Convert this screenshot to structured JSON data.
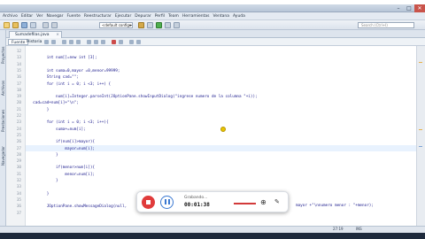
{
  "window": {
    "title": "",
    "controls": {
      "minimize": "–",
      "maximize": "□",
      "close": "✕"
    }
  },
  "menu": [
    "Archivo",
    "Editar",
    "Ver",
    "Navegar",
    "Fuente",
    "Reestructurar",
    "Ejecutar",
    "Depurar",
    "Perfil",
    "Team",
    "Herramientas",
    "Ventana",
    "Ayuda"
  ],
  "toolbar": {
    "config_value": "<default config>",
    "config_arrow": "▾",
    "search_placeholder": "Search (Ctrl+I)"
  },
  "left_panel_tabs": [
    "Proyectos",
    "Archivos",
    "Prestaciones",
    "Navegador"
  ],
  "editor": {
    "tab_label": "Sumadefilas.java",
    "tab_close": "×",
    "sub_tabs": [
      "Fuente",
      "Historia"
    ],
    "lines": [
      {
        "num": "12",
        "text": ""
      },
      {
        "num": "13",
        "text": "        int num[]=new int [3];"
      },
      {
        "num": "14",
        "text": ""
      },
      {
        "num": "15",
        "text": "        int suma=0,mayor =0,menor=99999;"
      },
      {
        "num": "16",
        "text": "        String cad=\"\";"
      },
      {
        "num": "17",
        "text": "        for (int i = 0; i <3; i++) {"
      },
      {
        "num": "18",
        "text": ""
      },
      {
        "num": "19",
        "text": "            num[i]=Integer.parseInt(JOptionPane.showInputDialog(\"ingrese numero de la columna \"+i));"
      },
      {
        "num": "20",
        "text": "  cad=cad+num[i]+\"\\n\";"
      },
      {
        "num": "21",
        "text": "        }"
      },
      {
        "num": "22",
        "text": ""
      },
      {
        "num": "23",
        "text": "        for (int i = 0; i <3; i++){"
      },
      {
        "num": "24",
        "text": "            suma+=num[i];"
      },
      {
        "num": "25",
        "text": ""
      },
      {
        "num": "26",
        "text": "            if(num[i]>mayor){"
      },
      {
        "num": "27",
        "text": "                mayor=num[i];"
      },
      {
        "num": "28",
        "text": "            }"
      },
      {
        "num": "29",
        "text": ""
      },
      {
        "num": "30",
        "text": "            if(menor>num[i]){"
      },
      {
        "num": "31",
        "text": "                menor=num[i];"
      },
      {
        "num": "32",
        "text": "            }"
      },
      {
        "num": "33",
        "text": ""
      },
      {
        "num": "34",
        "text": "        }"
      },
      {
        "num": "35",
        "text": ""
      },
      {
        "num": "36",
        "text": "        JOptionPane.showMessageDialog(null,"
      },
      {
        "num": "37",
        "text": ""
      }
    ],
    "line36_tail": "mayor +\"\\nnumero menor : \"+menor);"
  },
  "recorder": {
    "label": "Grabando...",
    "time": "00:01:38",
    "zoom_icon": "⊕",
    "pen_icon": "✎"
  },
  "statusbar": {
    "position": "27:19",
    "mode": "INS"
  },
  "colors": {
    "code_blue": "#1a1a8c",
    "stop_red": "#e03b3b",
    "pause_blue": "#3a78d1",
    "cursor_yellow": "#e9c400"
  }
}
